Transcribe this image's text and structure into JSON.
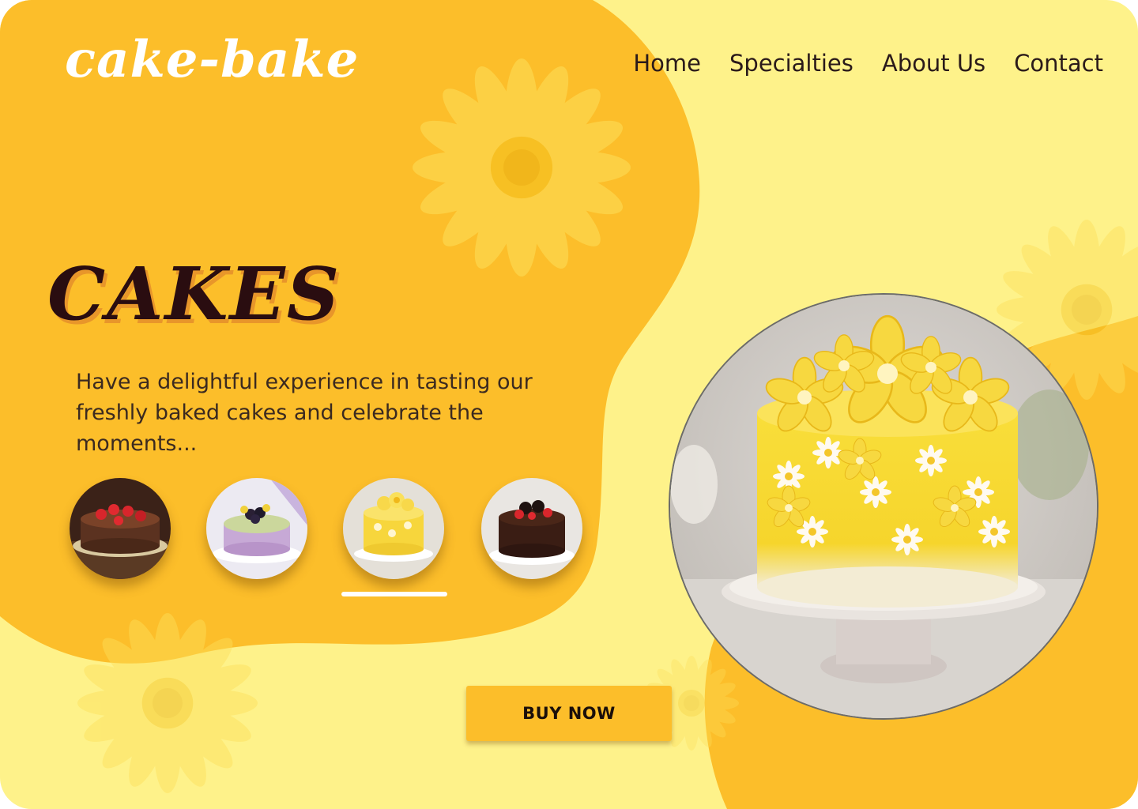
{
  "brand": {
    "logo": "cake-bake"
  },
  "nav": {
    "items": [
      "Home",
      "Specialties",
      "About Us",
      "Contact"
    ]
  },
  "hero": {
    "title": "CAKES",
    "tagline": "Have a delightful experience in tasting our freshly baked cakes and celebrate the moments..."
  },
  "thumbnails": [
    {
      "icon": "chocolate-strawberry-cake-icon"
    },
    {
      "icon": "blackberry-cheesecake-icon"
    },
    {
      "icon": "yellow-flower-cake-icon",
      "selected": true
    },
    {
      "icon": "chocolate-oreo-cake-icon"
    }
  ],
  "cta": {
    "label": "BUY NOW"
  },
  "colors": {
    "background": "#fef28a",
    "accent": "#fcbe2a",
    "title": "#2a0d10",
    "title_shadow": "#e8962a"
  }
}
